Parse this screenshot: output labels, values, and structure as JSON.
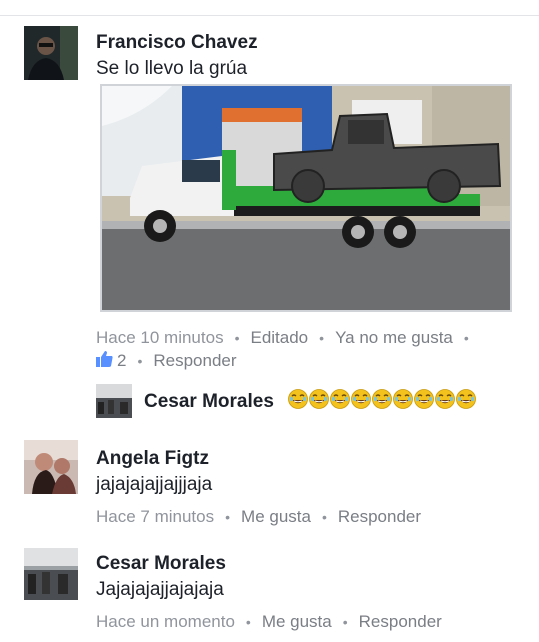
{
  "comments": [
    {
      "name": "Francisco Chavez",
      "text": "Se lo llevo la grúa",
      "time": "Hace 10 minutos",
      "edited": "Editado",
      "action": "Ya no me gusta",
      "likes": "2",
      "reply": "Responder"
    },
    {
      "name": "Angela Figtz",
      "text": "jajajajajjajjjaja",
      "time": "Hace 7 minutos",
      "action": "Me gusta",
      "reply": "Responder"
    },
    {
      "name": "Cesar Morales",
      "text": "Jajajajajjajajaja",
      "time": "Hace un momento",
      "action": "Me gusta",
      "reply": "Responder"
    }
  ],
  "reply": {
    "name": "Cesar Morales",
    "emoji_count": 9,
    "emoji_icon": "crying-laughing-emoji"
  },
  "colors": {
    "link_gray": "#90949c",
    "name_dark": "#1d2129",
    "like_blue": "#5890ff",
    "tow_green": "#2eaa3c"
  }
}
